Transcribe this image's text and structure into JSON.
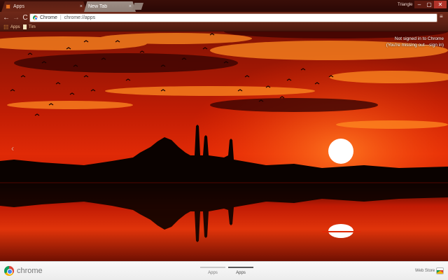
{
  "tabs": [
    {
      "label": "Apps",
      "close": "×"
    },
    {
      "label": "New Tab",
      "close": "×"
    }
  ],
  "window": {
    "profile_name": "Triangle",
    "minimize": "–",
    "maximize": "▢",
    "close": "✕"
  },
  "toolbar": {
    "back": "←",
    "forward": "→",
    "reload": "C",
    "chip_label": "Chrome",
    "separator": "|",
    "url": "chrome://apps",
    "star": "☆",
    "menu": "≡"
  },
  "bookmarks": [
    {
      "label": "Apps"
    },
    {
      "label": "Tim"
    }
  ],
  "signin": {
    "line1": "Not signed in to Chrome",
    "line2": "(You're missing out—sign in)"
  },
  "nav": {
    "prev_page": "‹"
  },
  "bottom_bar": {
    "logo_text": "chrome",
    "pages": [
      {
        "label": "Apps",
        "selected": false
      },
      {
        "label": "Apps",
        "selected": true
      }
    ],
    "webstore_label": "Web Store"
  },
  "colors": {
    "sky_top": "#5a0c02",
    "sky_mid": "#c01a05",
    "sun": "#ffffff",
    "silhouette": "#0a0200",
    "close_button": "#b2342a"
  }
}
